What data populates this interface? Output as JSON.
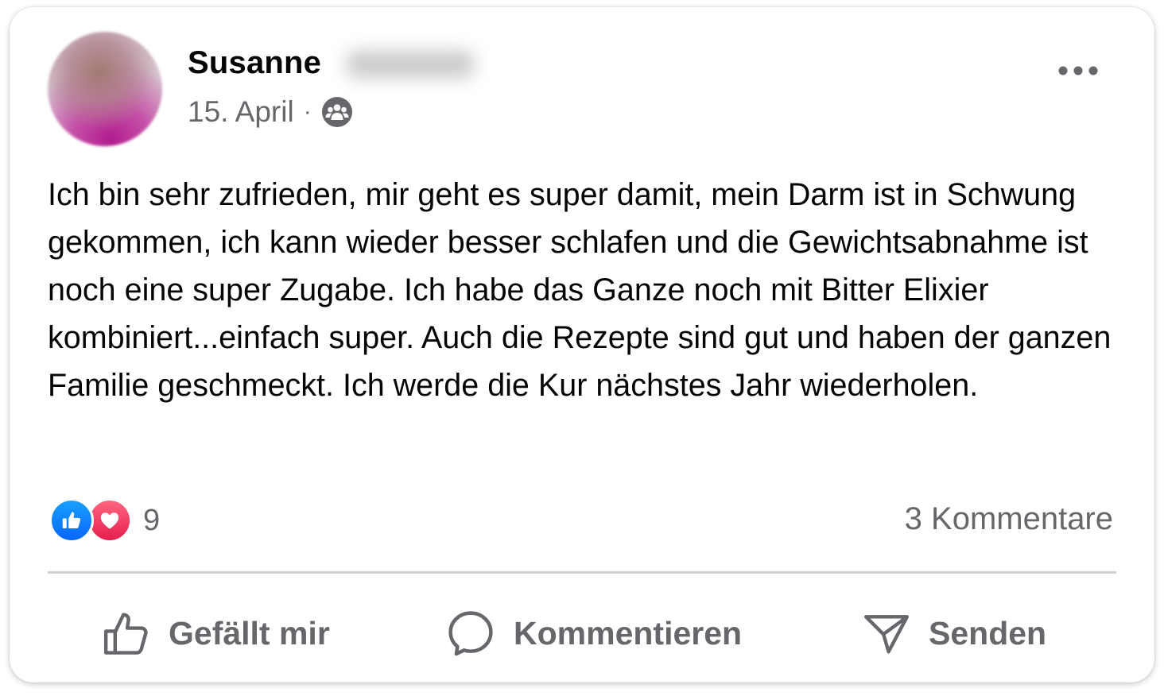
{
  "post": {
    "author_first_name": "Susanne",
    "author_last_name_blurred": "Fischer",
    "date": "15. April",
    "separator": "·",
    "audience_icon": "group-icon",
    "menu_icon": "more-horizontal-icon",
    "text": "Ich bin sehr zufrieden, mir geht es super damit, mein Darm ist in Schwung gekommen, ich kann wieder besser schlafen und die Gewichtsabnahme ist noch eine super Zugabe. Ich habe das Ganze noch mit Bitter Elixier kombiniert...einfach super. Auch die Rezepte sind gut und haben der ganzen Familie geschmeckt. Ich werde die Kur nächstes Jahr wiederholen."
  },
  "stats": {
    "reaction_icons": [
      "like-icon",
      "love-icon"
    ],
    "reaction_count": "9",
    "comments_label": "3 Kommentare"
  },
  "actions": {
    "like_label": "Gefällt mir",
    "comment_label": "Kommentieren",
    "send_label": "Senden"
  },
  "colors": {
    "text_primary": "#050505",
    "text_secondary": "#65676b",
    "like_blue": "#0866ff",
    "love_red": "#e61e4d",
    "divider": "#ced0d4"
  }
}
